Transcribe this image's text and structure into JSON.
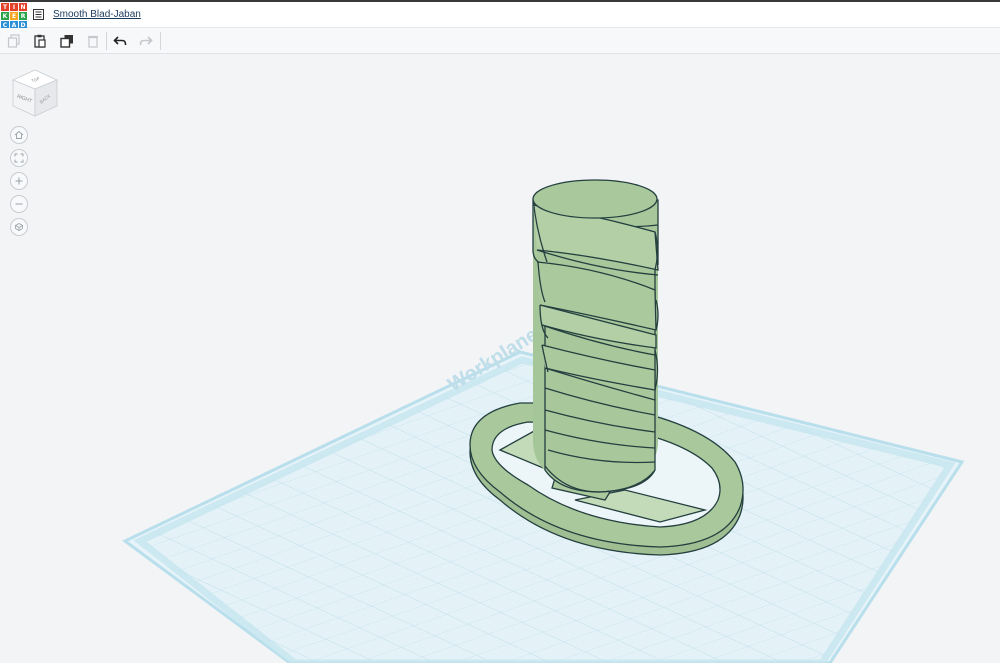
{
  "app": {
    "logo_letters": [
      "T",
      "I",
      "N",
      "K",
      "E",
      "R",
      "C",
      "A",
      "D"
    ],
    "logo_colors": [
      "#e4412b",
      "#e4412b",
      "#e4412b",
      "#2aa34a",
      "#f5a623",
      "#2aa34a",
      "#2d8fd5",
      "#2d8fd5",
      "#2d8fd5"
    ],
    "project_title": "Smooth Blad-Jaban"
  },
  "toolbar": {
    "buttons": [
      {
        "name": "copy",
        "icon": "copy-icon",
        "enabled": false
      },
      {
        "name": "paste",
        "icon": "paste-icon",
        "enabled": true
      },
      {
        "name": "duplicate",
        "icon": "duplicate-icon",
        "enabled": true
      },
      {
        "name": "delete",
        "icon": "trash-icon",
        "enabled": false
      },
      {
        "name": "undo",
        "icon": "undo-icon",
        "enabled": true
      },
      {
        "name": "redo",
        "icon": "redo-icon",
        "enabled": false
      }
    ]
  },
  "viewcube": {
    "front_label": "RIGHT",
    "side_label": "BACK",
    "top_label": "TOP"
  },
  "nav": [
    "home-icon",
    "fit-view-icon",
    "zoom-in-icon",
    "zoom-out-icon",
    "perspective-icon"
  ],
  "workplane": {
    "label": "Workplane"
  },
  "colors": {
    "shape": "#a7c79a",
    "shape_edge": "#243f3f",
    "grid": "#d8ecf3",
    "grid_border": "#b0dbe8"
  }
}
